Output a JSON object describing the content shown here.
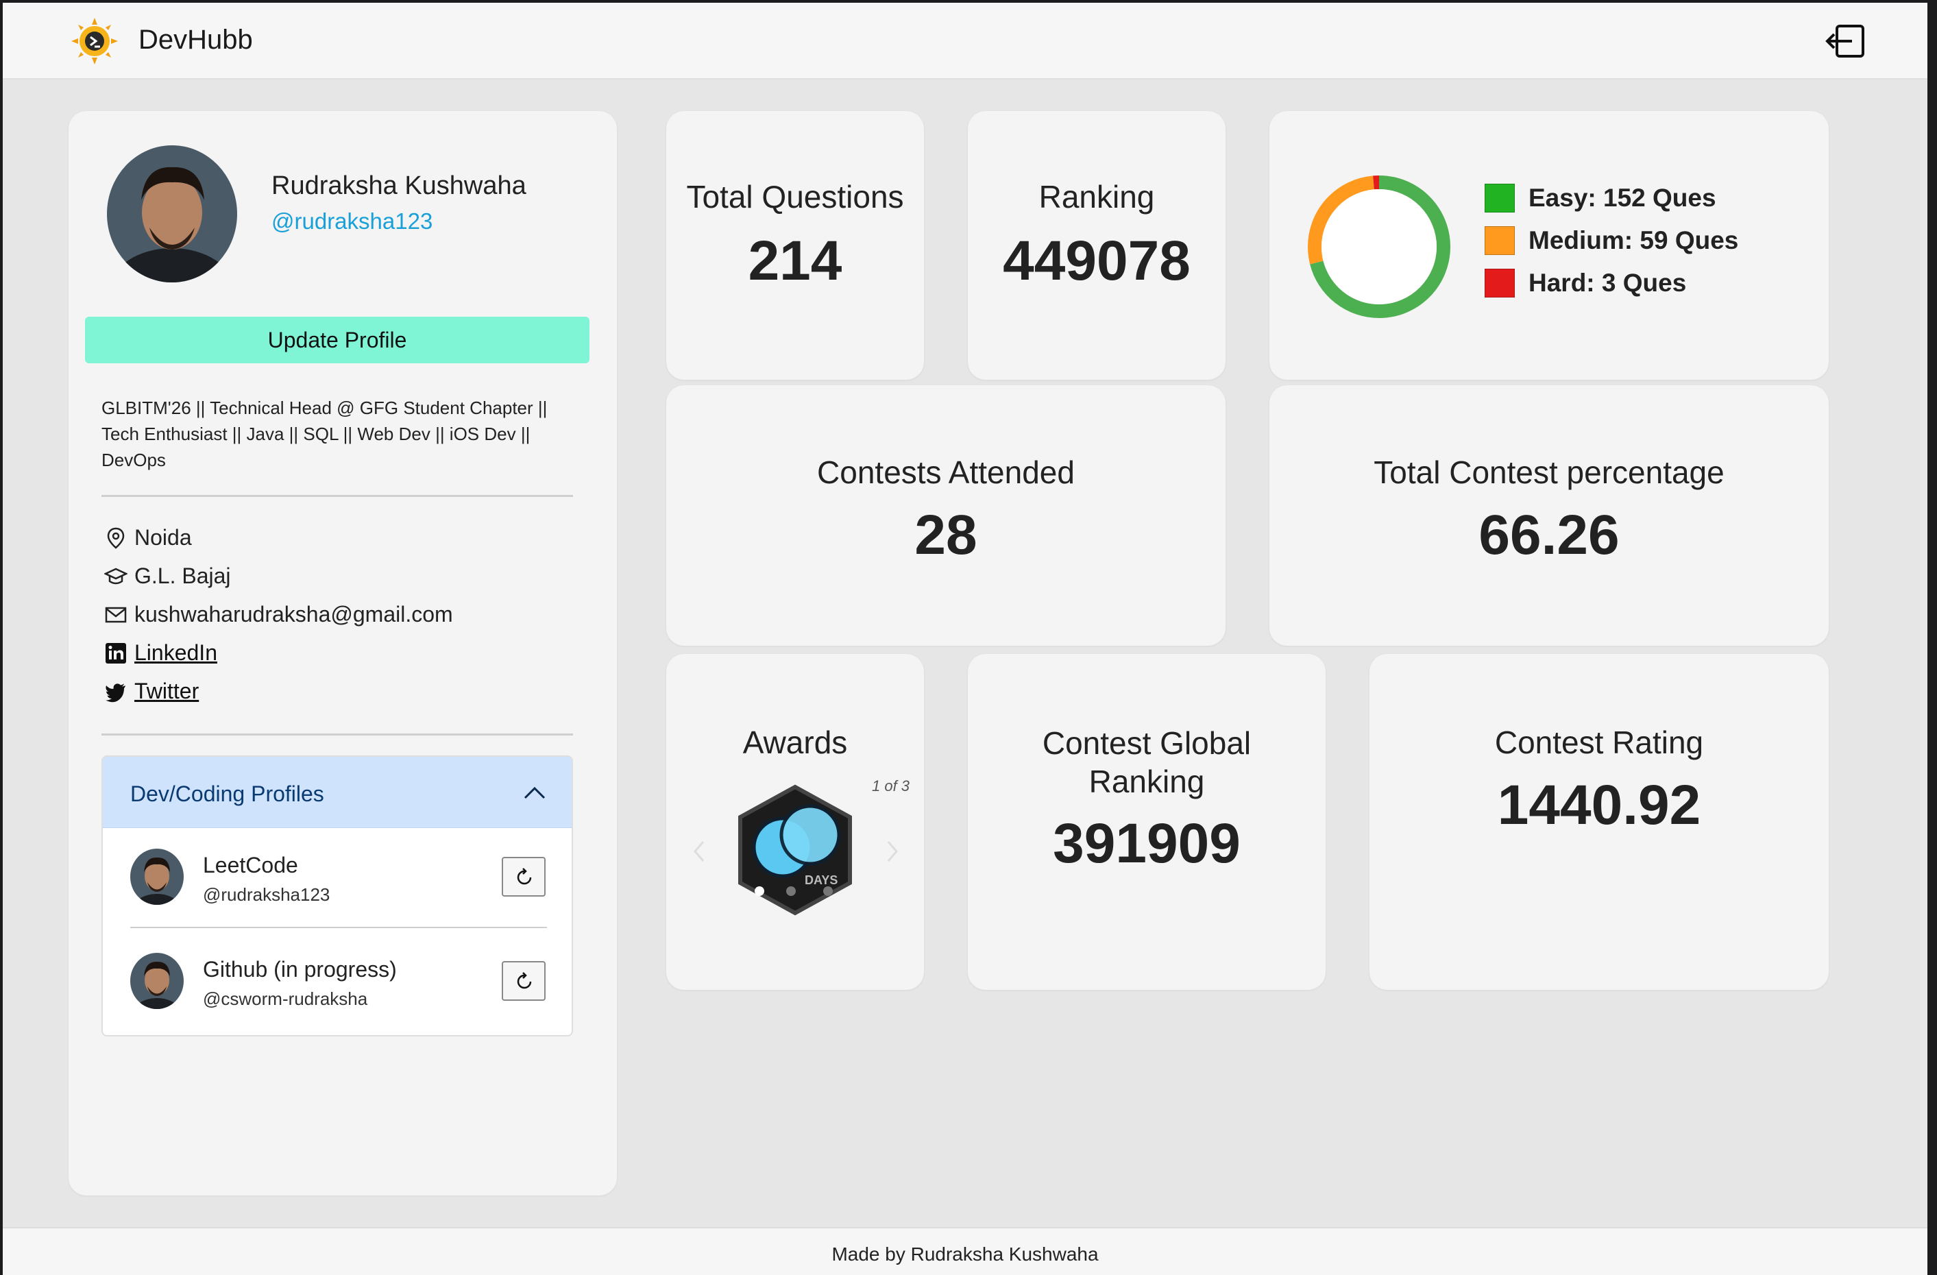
{
  "navbar": {
    "brand": "DevHubb",
    "logo_icon": "sun-logo-icon",
    "logout_icon": "logout-icon"
  },
  "profile": {
    "name": "Rudraksha Kushwaha",
    "handle": "@rudraksha123",
    "update_button": "Update Profile",
    "bio": "GLBITM'26 || Technical Head @ GFG Student Chapter || Tech Enthusiast || Java || SQL || Web Dev || iOS Dev || DevOps",
    "location": "Noida",
    "school": "G.L. Bajaj",
    "email": "kushwaharudraksha@gmail.com",
    "linkedin": "LinkedIn",
    "twitter": "Twitter"
  },
  "dev_profiles": {
    "title": "Dev/Coding Profiles",
    "items": [
      {
        "title": "LeetCode",
        "handle": "@rudraksha123"
      },
      {
        "title": "Github (in progress)",
        "handle": "@csworm-rudraksha"
      }
    ]
  },
  "stats": {
    "total_questions": {
      "label": "Total Questions",
      "value": "214"
    },
    "ranking": {
      "label": "Ranking",
      "value": "449078"
    },
    "contests_attended": {
      "label": "Contests Attended",
      "value": "28"
    },
    "contest_percentage": {
      "label": "Total Contest percentage",
      "value": "66.26"
    },
    "contest_global_ranking": {
      "label": "Contest Global Ranking",
      "value": "391909"
    },
    "contest_rating": {
      "label": "Contest Rating",
      "value": "1440.92"
    }
  },
  "difficulty": {
    "legend": [
      {
        "label": "Easy: 152 Ques",
        "count": 152,
        "color": "#22b322"
      },
      {
        "label": "Medium: 59 Ques",
        "count": 59,
        "color": "#ff9a1f"
      },
      {
        "label": "Hard: 3 Ques",
        "count": 3,
        "color": "#e31b1b"
      }
    ]
  },
  "awards": {
    "label": "Awards",
    "counter": "1 of 3",
    "badge_text": "DAYS"
  },
  "footer": {
    "text": "Made by Rudraksha Kushwaha"
  }
}
